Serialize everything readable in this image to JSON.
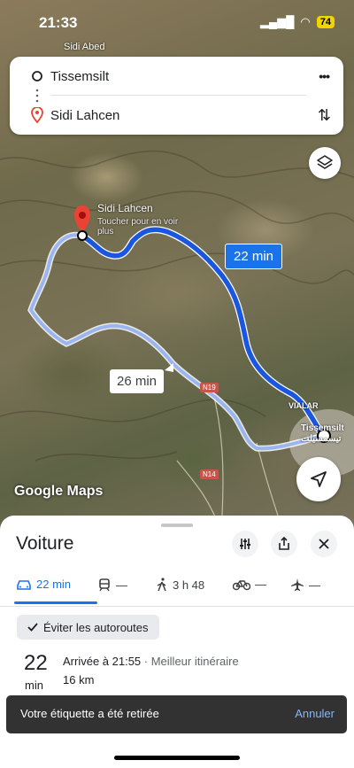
{
  "status_bar": {
    "time": "21:33",
    "battery": "74"
  },
  "map": {
    "top_label": "Sidi Abed",
    "pin_name": "Sidi Lahcen",
    "pin_hint": "Toucher pour en voir plus",
    "route_primary_time": "22 min",
    "route_alt_time": "26 min",
    "town_label": "Tissemsilt",
    "town_label_ar": "تيسمسيلت",
    "area_label": "VIALAR",
    "road_n19": "N19",
    "road_n14": "N14",
    "logo": "Google Maps"
  },
  "route_card": {
    "origin": "Tissemsilt",
    "destination": "Sidi Lahcen",
    "more_label": "•••",
    "swap_label": "⇅"
  },
  "sheet": {
    "title": "Voiture",
    "modes": [
      {
        "name": "car",
        "label": "22 min"
      },
      {
        "name": "transit",
        "label": "—"
      },
      {
        "name": "walk",
        "label": "3 h 48"
      },
      {
        "name": "bike",
        "label": "—"
      },
      {
        "name": "flight",
        "label": "—"
      }
    ],
    "chip": "Éviter les autoroutes",
    "duration_number": "22",
    "duration_unit": "min",
    "arrival": "Arrivée à 21:55",
    "arrival_meta": " · Meilleur itinéraire",
    "distance": "16 km"
  },
  "toast": {
    "message": "Votre étiquette a été retirée",
    "action": "Annuler"
  }
}
